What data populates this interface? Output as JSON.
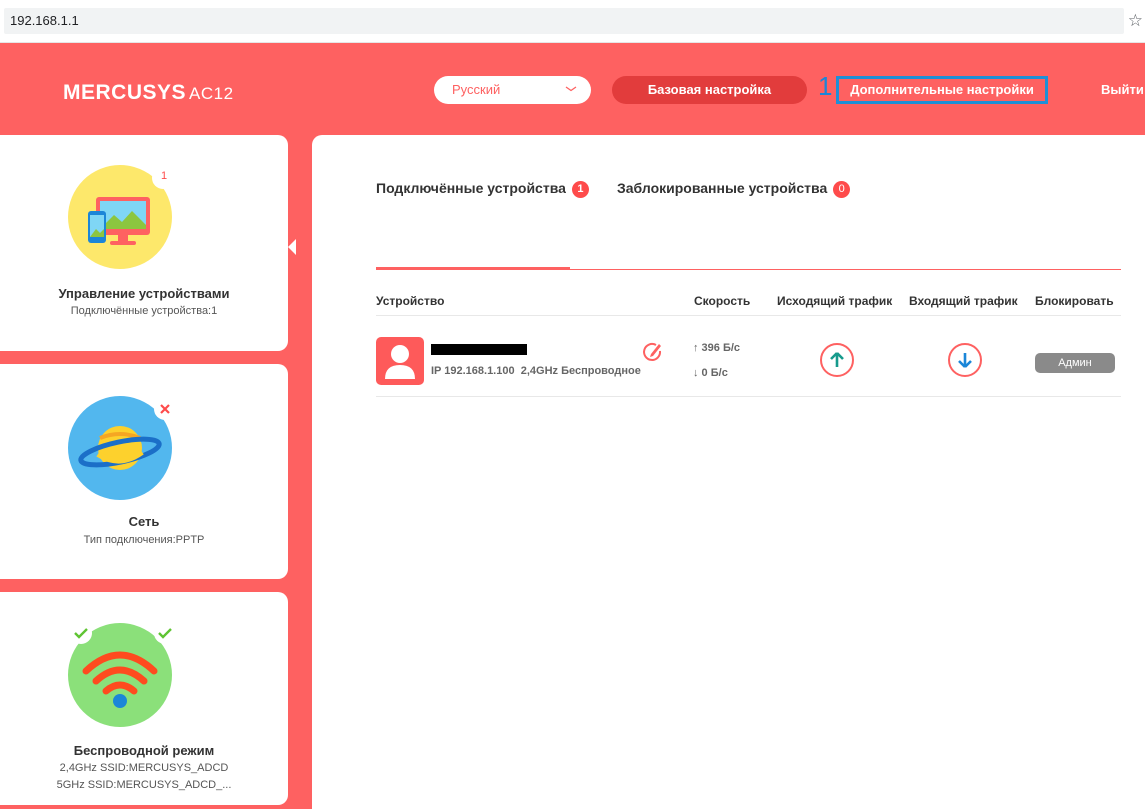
{
  "browser": {
    "address": "192.168.1.1",
    "bookmark_icon": "star-icon"
  },
  "header": {
    "brand": "MERCUSYS",
    "model": "AC12",
    "language": "Русский",
    "basic_setup": "Базовая настройка",
    "annotation_number": "1",
    "advanced_setup": "Дополнительные настройки",
    "logout": "Выйти"
  },
  "sidebar": {
    "cards": [
      {
        "title": "Управление устройствами",
        "subtitle": "Подключённые устройства:1",
        "badge": "1"
      },
      {
        "title": "Сеть",
        "subtitle": "Тип подключения:PPTP"
      },
      {
        "title": "Беспроводной режим",
        "subtitle_1": "2,4GHz SSID:MERCUSYS_ADCD",
        "subtitle_2": "5GHz SSID:MERCUSYS_ADCD_..."
      }
    ]
  },
  "main": {
    "tabs": [
      {
        "label": "Подключённые устройства",
        "count": "1"
      },
      {
        "label": "Заблокированные устройства",
        "count": "0"
      }
    ],
    "columns": [
      "Устройство",
      "Скорость",
      "Исходящий трафик",
      "Входящий трафик",
      "Блокировать"
    ],
    "rows": [
      {
        "ip": "IP 192.168.1.100",
        "connection": "2,4GHz Беспроводное",
        "upload_speed": "↑ 396 Б/с",
        "download_speed": "↓ 0 Б/с",
        "block_label": "Админ"
      }
    ]
  },
  "colors": {
    "accent": "#fe6161",
    "badge": "#fe4b4b",
    "highlight": "#1e8fd6"
  }
}
